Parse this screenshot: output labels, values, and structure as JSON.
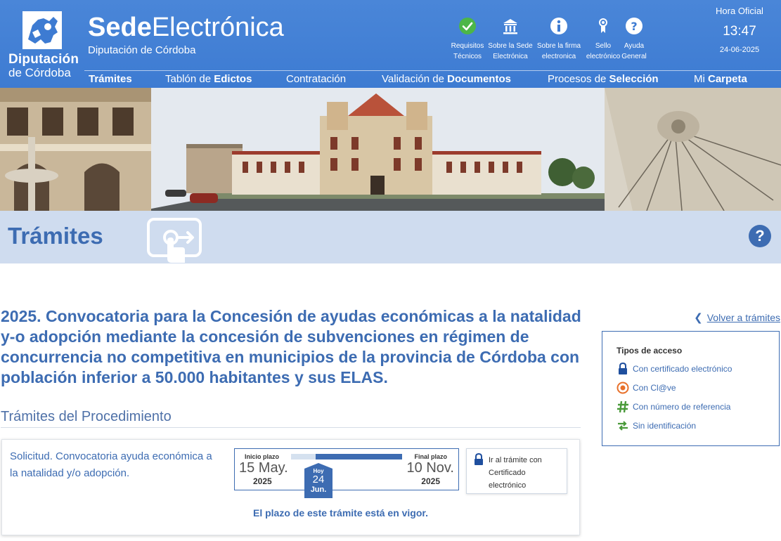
{
  "header": {
    "logo_line1": "Diputación",
    "logo_line2": "de Córdoba",
    "brand_bold": "Sede",
    "brand_light": "Electrónica",
    "brand_sub": "Diputación de Córdoba",
    "quick_links": [
      {
        "icon": "check-circle-icon",
        "line1": "Requisitos",
        "line2": "Técnicos"
      },
      {
        "icon": "institution-icon",
        "line1": "Sobre la Sede",
        "line2": "Electrónica"
      },
      {
        "icon": "info-icon",
        "line1": "Sobre la firma",
        "line2": "electronica"
      },
      {
        "icon": "ribbon-seal-icon",
        "line1": "Sello",
        "line2": "electrónico"
      },
      {
        "icon": "question-icon",
        "line1": "Ayuda",
        "line2": "General"
      }
    ],
    "clock": {
      "label": "Hora Oficial",
      "time": "13:47",
      "date": "24-06-2025"
    }
  },
  "nav": {
    "items": [
      {
        "light": "",
        "bold": "Trámites"
      },
      {
        "light": "Tablón de ",
        "bold": "Edictos"
      },
      {
        "light": "Contratación",
        "bold": ""
      },
      {
        "light": "Validación de ",
        "bold": "Documentos"
      },
      {
        "light": "Procesos de ",
        "bold": "Selección"
      },
      {
        "light": "Mi ",
        "bold": "Carpeta"
      }
    ]
  },
  "page": {
    "title": "Trámites",
    "help_label": "?",
    "procedure_title": "2025. Convocatoria para la Concesión de ayudas económicas a la natalidad y-o adopción mediante la concesión de subvenciones en régimen de concurrencia no competitiva en municipios de la provincia de Córdoba con población inferior a 50.000 habitantes y sus ELAS.",
    "back_link": "Volver a trámites",
    "section_title": "Trámites del Procedimiento"
  },
  "access": {
    "title": "Tipos de acceso",
    "items": [
      {
        "icon": "lock-icon",
        "label": "Con certificado electrónico",
        "color": "#1f4f9e"
      },
      {
        "icon": "clave-icon",
        "label": "Con Cl@ve",
        "color": "#e8702a"
      },
      {
        "icon": "hash-icon",
        "label": "Con número de referencia",
        "color": "#4a9a3a"
      },
      {
        "icon": "arrows-icon",
        "label": "Sin identificación",
        "color": "#4a9a3a"
      }
    ]
  },
  "tramite": {
    "description": "Solicitud. Convocatoria ayuda económica a la natalidad y/o adopción.",
    "start_label": "Inicio plazo",
    "start_date": "15 May.",
    "start_year": "2025",
    "end_label": "Final plazo",
    "end_date": "10 Nov.",
    "end_year": "2025",
    "today_label": "Hoy",
    "today_day": "24",
    "today_month": "Jun.",
    "progress": 0.22,
    "status": "El plazo de este trámite está en vigor.",
    "go_button": "Ir al trámite con Certificado electrónico"
  },
  "colors": {
    "header_blue": "#4382d6",
    "accent_blue": "#3d6cb2",
    "title_bar": "#cfdcef"
  }
}
